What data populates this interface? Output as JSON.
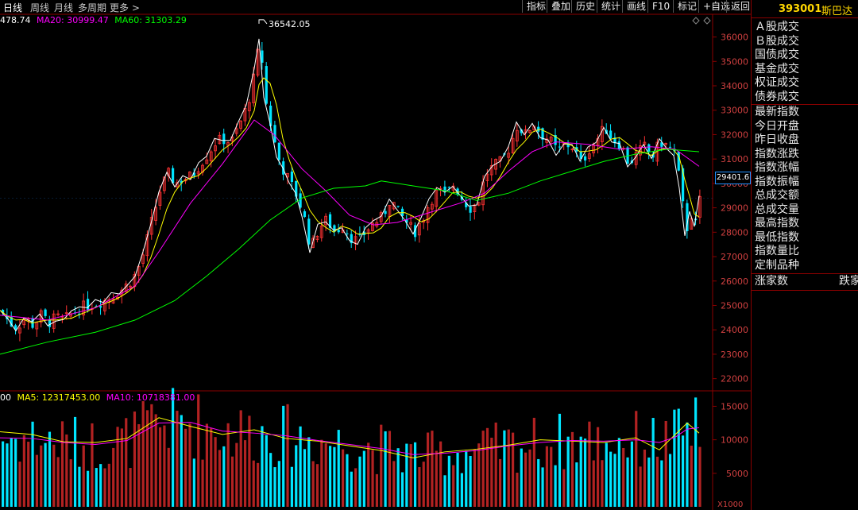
{
  "tabs": [
    {
      "label": "日线",
      "active": true
    },
    {
      "label": "周线",
      "active": false
    },
    {
      "label": "月线",
      "active": false
    },
    {
      "label": "多周期",
      "active": false
    },
    {
      "label": "更多 >",
      "active": false
    }
  ],
  "toolbar": [
    "指标",
    "叠加",
    "历史",
    "统计",
    "画线",
    "F10",
    "标记",
    "+自选",
    "返回"
  ],
  "ma_legend": {
    "ma5": "478.74",
    "ma20": "MA20: 30999.47",
    "ma60": "MA60: 31303.29",
    "colors": {
      "ma5": "#ffffff",
      "ma20": "#ff00ff",
      "ma60": "#00ff00"
    }
  },
  "vol_legend": {
    "vol": "00",
    "ma5": "MA5: 12317453.00",
    "ma10": "MA10: 10718381.00",
    "colors": {
      "ma5": "#ffff00",
      "ma10": "#ff00ff"
    }
  },
  "sidebar": {
    "code": "393001",
    "name": "斯巴达",
    "group1": [
      "Ａ股成交",
      "Ｂ股成交",
      "国债成交",
      "基金成交",
      "权证成交",
      "债券成交"
    ],
    "group2": [
      "最新指数",
      "今日开盘",
      "昨日收盘",
      "指数涨跌",
      "指数涨幅",
      "指数振幅",
      "总成交额",
      "总成交量",
      "最高指数",
      "最低指数",
      "指数量比",
      "定制品种"
    ],
    "rise_label": "涨家数",
    "fall_label": "跌家"
  },
  "current_price": "29401.6",
  "peak_annotation": "36542.05",
  "volume_unit": "X1000",
  "chart_data": {
    "type": "candlestick",
    "price_axis": {
      "ticks": [
        22000,
        23000,
        24000,
        25000,
        26000,
        27000,
        28000,
        29000,
        30000,
        31000,
        32000,
        33000,
        34000,
        35000,
        36000
      ],
      "range": [
        21500,
        36800
      ]
    },
    "volume_axis": {
      "ticks": [
        5000,
        10000,
        15000
      ],
      "range": [
        0,
        16000
      ]
    },
    "peak": 36542.05,
    "last_close": 29401.6,
    "up_color": "#ff3232",
    "down_color": "#00e5ff",
    "close_path": [
      [
        0,
        24800
      ],
      [
        10,
        24300
      ],
      [
        20,
        24100
      ],
      [
        30,
        24500
      ],
      [
        40,
        24200
      ],
      [
        50,
        24600
      ],
      [
        60,
        24300
      ],
      [
        70,
        24500
      ],
      [
        80,
        24400
      ],
      [
        90,
        24700
      ],
      [
        100,
        24900
      ],
      [
        110,
        25000
      ],
      [
        120,
        25100
      ],
      [
        130,
        25200
      ],
      [
        140,
        25400
      ],
      [
        150,
        25600
      ],
      [
        160,
        25900
      ],
      [
        170,
        26300
      ],
      [
        180,
        27200
      ],
      [
        190,
        28500
      ],
      [
        200,
        29700
      ],
      [
        210,
        30400
      ],
      [
        220,
        30000
      ],
      [
        230,
        30200
      ],
      [
        240,
        30300
      ],
      [
        250,
        30800
      ],
      [
        260,
        31200
      ],
      [
        270,
        31700
      ],
      [
        280,
        31800
      ],
      [
        290,
        31700
      ],
      [
        300,
        32400
      ],
      [
        310,
        33200
      ],
      [
        320,
        34600
      ],
      [
        326,
        36000
      ],
      [
        332,
        33500
      ],
      [
        340,
        32300
      ],
      [
        348,
        31100
      ],
      [
        356,
        30500
      ],
      [
        364,
        30000
      ],
      [
        372,
        29500
      ],
      [
        380,
        28800
      ],
      [
        390,
        27300
      ],
      [
        400,
        28200
      ],
      [
        410,
        28500
      ],
      [
        420,
        28000
      ],
      [
        430,
        28300
      ],
      [
        440,
        27800
      ],
      [
        450,
        27600
      ],
      [
        460,
        28100
      ],
      [
        470,
        28400
      ],
      [
        480,
        28600
      ],
      [
        490,
        29400
      ],
      [
        500,
        28800
      ],
      [
        510,
        28400
      ],
      [
        520,
        28000
      ],
      [
        530,
        28500
      ],
      [
        540,
        29300
      ],
      [
        550,
        29700
      ],
      [
        560,
        29500
      ],
      [
        570,
        30000
      ],
      [
        580,
        29400
      ],
      [
        590,
        29000
      ],
      [
        600,
        29200
      ],
      [
        610,
        30400
      ],
      [
        620,
        30700
      ],
      [
        630,
        30900
      ],
      [
        640,
        31500
      ],
      [
        650,
        32400
      ],
      [
        660,
        32000
      ],
      [
        670,
        32500
      ],
      [
        680,
        32000
      ],
      [
        690,
        31800
      ],
      [
        700,
        31300
      ],
      [
        710,
        31600
      ],
      [
        720,
        31500
      ],
      [
        730,
        30800
      ],
      [
        740,
        31400
      ],
      [
        750,
        31800
      ],
      [
        760,
        32300
      ],
      [
        770,
        31800
      ],
      [
        780,
        31600
      ],
      [
        790,
        30800
      ],
      [
        800,
        31200
      ],
      [
        810,
        31500
      ],
      [
        820,
        31100
      ],
      [
        830,
        31700
      ],
      [
        840,
        31500
      ],
      [
        848,
        31200
      ],
      [
        855,
        29900
      ],
      [
        862,
        28000
      ],
      [
        868,
        28800
      ],
      [
        874,
        28300
      ],
      [
        880,
        29400
      ]
    ],
    "ma_paths": {
      "ma20": [
        [
          0,
          24600
        ],
        [
          60,
          24400
        ],
        [
          120,
          24900
        ],
        [
          170,
          25800
        ],
        [
          200,
          27200
        ],
        [
          240,
          29200
        ],
        [
          280,
          30800
        ],
        [
          320,
          32600
        ],
        [
          345,
          32000
        ],
        [
          380,
          30600
        ],
        [
          410,
          29700
        ],
        [
          440,
          28700
        ],
        [
          470,
          28300
        ],
        [
          500,
          28400
        ],
        [
          540,
          28800
        ],
        [
          580,
          29200
        ],
        [
          610,
          29600
        ],
        [
          640,
          30500
        ],
        [
          670,
          31300
        ],
        [
          700,
          31700
        ],
        [
          740,
          31600
        ],
        [
          780,
          31400
        ],
        [
          820,
          31500
        ],
        [
          850,
          31400
        ],
        [
          880,
          30700
        ]
      ],
      "ma60": [
        [
          0,
          23000
        ],
        [
          60,
          23500
        ],
        [
          120,
          23900
        ],
        [
          170,
          24400
        ],
        [
          220,
          25200
        ],
        [
          260,
          26200
        ],
        [
          300,
          27300
        ],
        [
          340,
          28500
        ],
        [
          380,
          29400
        ],
        [
          420,
          29800
        ],
        [
          460,
          29900
        ],
        [
          480,
          30100
        ],
        [
          520,
          29900
        ],
        [
          560,
          29700
        ],
        [
          600,
          29300
        ],
        [
          640,
          29600
        ],
        [
          680,
          30100
        ],
        [
          720,
          30500
        ],
        [
          760,
          30900
        ],
        [
          800,
          31200
        ],
        [
          840,
          31400
        ],
        [
          880,
          31300
        ]
      ]
    },
    "volume_ma": {
      "ma5": [
        [
          0,
          11200
        ],
        [
          40,
          10800
        ],
        [
          80,
          9700
        ],
        [
          120,
          9600
        ],
        [
          160,
          10200
        ],
        [
          200,
          13300
        ],
        [
          240,
          12000
        ],
        [
          280,
          10800
        ],
        [
          320,
          11500
        ],
        [
          360,
          10200
        ],
        [
          400,
          9800
        ],
        [
          440,
          9100
        ],
        [
          480,
          8400
        ],
        [
          520,
          7300
        ],
        [
          560,
          8200
        ],
        [
          600,
          8600
        ],
        [
          640,
          9200
        ],
        [
          680,
          10000
        ],
        [
          720,
          9800
        ],
        [
          760,
          9600
        ],
        [
          800,
          10300
        ],
        [
          830,
          8500
        ],
        [
          850,
          10800
        ],
        [
          865,
          12500
        ],
        [
          880,
          11000
        ]
      ],
      "ma10": [
        [
          0,
          10300
        ],
        [
          40,
          10200
        ],
        [
          80,
          9600
        ],
        [
          120,
          9300
        ],
        [
          160,
          9900
        ],
        [
          200,
          12500
        ],
        [
          240,
          12600
        ],
        [
          280,
          11300
        ],
        [
          320,
          11000
        ],
        [
          360,
          10600
        ],
        [
          400,
          9900
        ],
        [
          440,
          9300
        ],
        [
          480,
          8700
        ],
        [
          520,
          7800
        ],
        [
          560,
          8000
        ],
        [
          600,
          8400
        ],
        [
          640,
          9100
        ],
        [
          680,
          9600
        ],
        [
          720,
          9900
        ],
        [
          760,
          9800
        ],
        [
          800,
          10000
        ],
        [
          830,
          9600
        ],
        [
          850,
          10400
        ],
        [
          865,
          11600
        ],
        [
          880,
          11800
        ]
      ]
    }
  }
}
